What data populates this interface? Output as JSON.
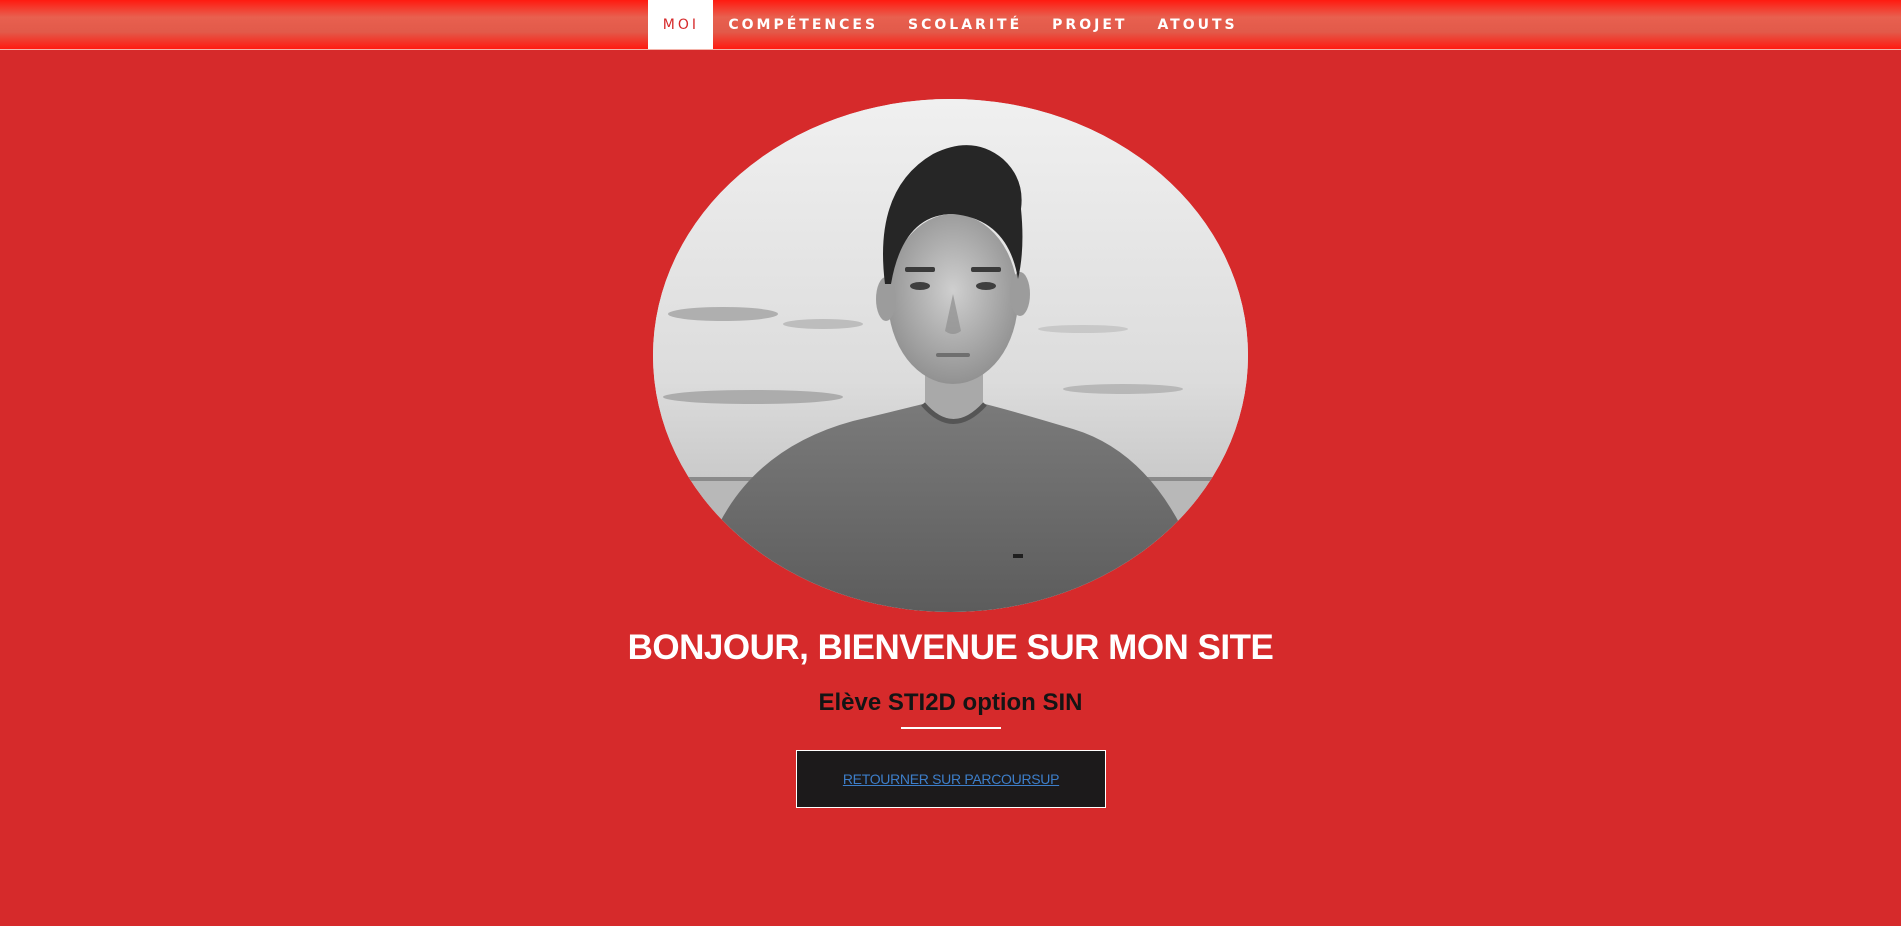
{
  "nav": {
    "items": [
      {
        "label": "MOI"
      },
      {
        "label": "COMPÉTENCES"
      },
      {
        "label": "SCOLARITÉ"
      },
      {
        "label": "PROJET"
      },
      {
        "label": "ATOUTS"
      }
    ],
    "active_index": 0
  },
  "hero": {
    "title": "BONJOUR, BIENVENUE SUR MON SITE",
    "subtitle": "Elève STI2D option SIN",
    "cta_label": "RETOURNER SUR PARCOURSUP"
  },
  "colors": {
    "background": "#d62a2b",
    "nav_active_text": "#d62a2b",
    "cta_background": "#1c1a1b",
    "cta_link": "#3d7ec9"
  },
  "icons": {
    "portrait": "portrait-photo"
  }
}
